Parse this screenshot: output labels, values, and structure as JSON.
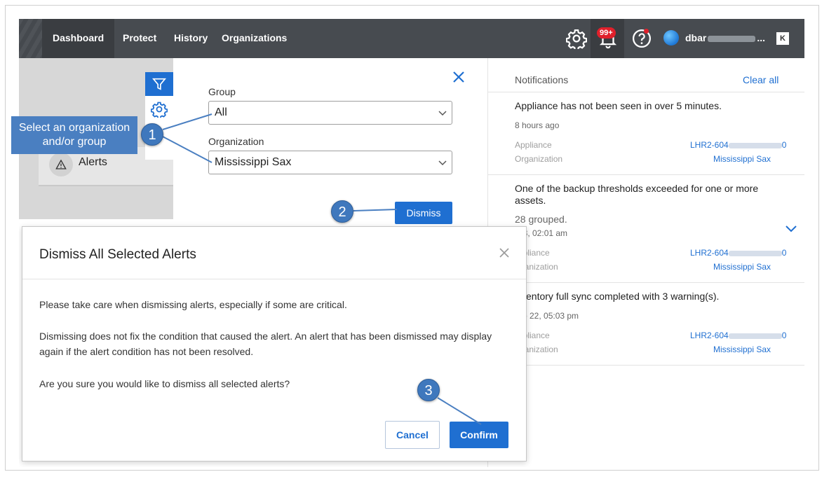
{
  "nav": {
    "items": [
      {
        "label": "Dashboard"
      },
      {
        "label": "Protect"
      },
      {
        "label": "History"
      },
      {
        "label": "Organizations"
      }
    ],
    "notification_badge": "99+",
    "user_name_prefix": "dbar",
    "user_name_suffix": "...",
    "brand_logo_text": "K",
    "icons": [
      "gear-icon",
      "bell-icon",
      "help-icon",
      "avatar",
      "brand-logo"
    ]
  },
  "sidebar": {
    "alerts_label": "Alerts",
    "icons": [
      "filter-icon",
      "gear-icon",
      "warning-icon"
    ]
  },
  "filter": {
    "group_label": "Group",
    "group_value": "All",
    "organization_label": "Organization",
    "organization_value": "Mississippi Sax",
    "dismiss_label": "Dismiss"
  },
  "notifications": {
    "title": "Notifications",
    "clear_all": "Clear all",
    "items": [
      {
        "message": "Appliance has not been seen in over 5 minutes.",
        "time": "8 hours ago",
        "appliance_key": "Appliance",
        "appliance_value": "LHR2-604",
        "appliance_end": "0",
        "organization_key": "Organization",
        "organization_value": "Mississippi Sax"
      },
      {
        "message": "One of the backup thresholds exceeded for one or more assets.",
        "grouped": "28 grouped.",
        "time": "t 3, 02:01 am",
        "appliance_key": "ppliance",
        "appliance_value": "LHR2-604",
        "appliance_end": "0",
        "organization_key": "ganization",
        "organization_value": "Mississippi Sax"
      },
      {
        "message": "ventory full sync completed with 3 warning(s).",
        "time": "p 22, 05:03 pm",
        "appliance_key": "ppliance",
        "appliance_value": "LHR2-604",
        "appliance_end": "0",
        "organization_key": "ganization",
        "organization_value": "Mississippi Sax"
      }
    ]
  },
  "dialog": {
    "title": "Dismiss All Selected Alerts",
    "paragraph1": "Please take care when dismissing alerts, especially if some are critical.",
    "paragraph2": "Dismissing does not fix the condition that caused the alert. An alert that has been dismissed may display again if the alert condition has not been resolved.",
    "paragraph3": "Are you sure you would like to dismiss all selected alerts?",
    "cancel_label": "Cancel",
    "confirm_label": "Confirm"
  },
  "annotations": {
    "callout_text": "Select an organization and/or group",
    "step1": "1",
    "step2": "2",
    "step3": "3",
    "color": "#3f78bd"
  },
  "colors": {
    "nav_bg": "#474b50",
    "accent": "#1f6fd1",
    "badge": "#e0202b"
  }
}
